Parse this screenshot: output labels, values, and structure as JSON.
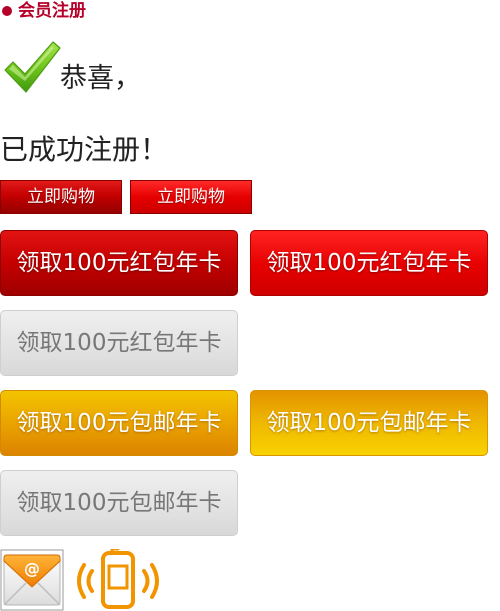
{
  "header": {
    "title": "会员注册",
    "accent_color": "#b5002a"
  },
  "message": {
    "congrats": "恭喜，",
    "registered": "已成功注册！",
    "icon": "checkmark-icon"
  },
  "buy_buttons": [
    {
      "label": "立即购物"
    },
    {
      "label": "立即购物"
    }
  ],
  "coupons": {
    "red_envelope": [
      {
        "label": "领取100元红包年卡",
        "state": "active"
      },
      {
        "label": "领取100元红包年卡",
        "state": "hover"
      },
      {
        "label": "领取100元红包年卡",
        "state": "disabled"
      }
    ],
    "free_shipping": [
      {
        "label": "领取100元包邮年卡",
        "state": "active"
      },
      {
        "label": "领取100元包邮年卡",
        "state": "hover"
      },
      {
        "label": "领取100元包邮年卡",
        "state": "disabled"
      }
    ]
  },
  "icons": {
    "email": "email-icon",
    "phone": "mobile-phone-icon"
  },
  "colors": {
    "red": "#c50000",
    "gold": "#eaa400",
    "gray": "#e2e2e2",
    "check_green": "#6cc21a"
  }
}
